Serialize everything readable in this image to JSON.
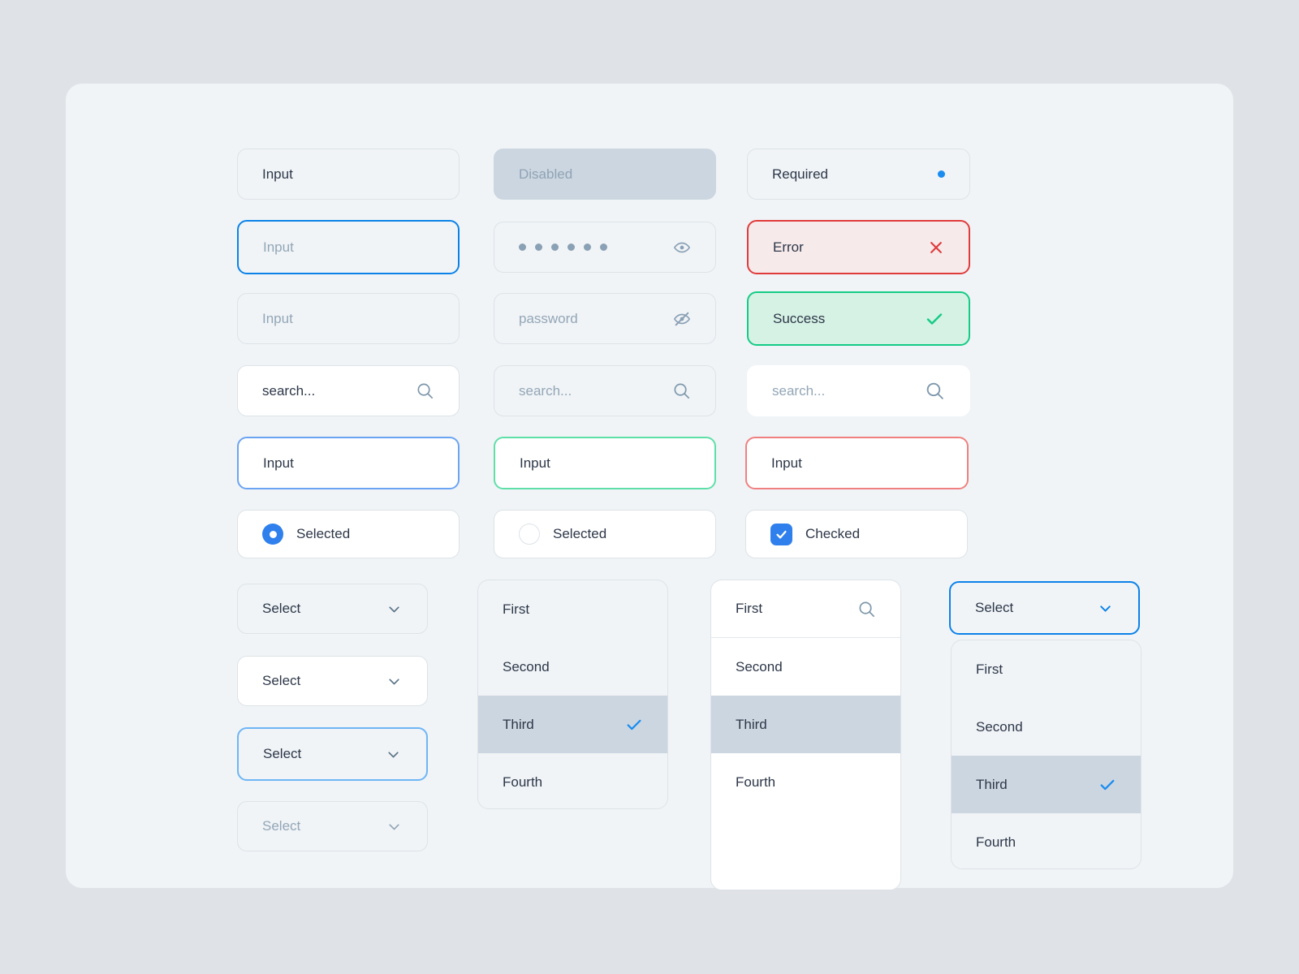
{
  "colors": {
    "page_bg": "#dfe2e6",
    "card_bg": "#f0f4f7",
    "accent_blue": "#0b82e8",
    "error_red": "#e03b3b",
    "success_green": "#14cb85",
    "muted_text": "#93a6b6",
    "text": "#2d3748",
    "selected_row": "#ccd6e0"
  },
  "inputs": {
    "row1": {
      "default": {
        "value": "Input"
      },
      "disabled": {
        "value": "Disabled"
      },
      "required": {
        "value": "Required",
        "indicator": "required-dot"
      }
    },
    "row2": {
      "focused": {
        "placeholder": "Input"
      },
      "password_filled": {
        "value": "••••••",
        "dots": 6,
        "icon": "eye-icon"
      },
      "error": {
        "value": "Error",
        "icon": "close-x-icon"
      }
    },
    "row3": {
      "muted": {
        "placeholder": "Input"
      },
      "password_empty": {
        "placeholder": "password",
        "icon": "eye-off-icon"
      },
      "success": {
        "value": "Success",
        "icon": "check-icon"
      }
    },
    "row4": {
      "search_filled": {
        "value": "search...",
        "icon": "search-icon"
      },
      "search_muted": {
        "placeholder": "search...",
        "icon": "search-icon"
      },
      "search_white": {
        "placeholder": "search...",
        "icon": "search-icon"
      }
    },
    "row5": {
      "blue_border": {
        "value": "Input"
      },
      "green_border": {
        "value": "Input"
      },
      "red_border": {
        "value": "Input"
      }
    }
  },
  "controls": {
    "radio_selected": {
      "label": "Selected",
      "state": "on"
    },
    "radio_unselected": {
      "label": "Selected",
      "state": "off"
    },
    "checkbox_checked": {
      "label": "Checked",
      "state": "on"
    }
  },
  "selects": {
    "default": {
      "value": "Select",
      "icon": "chevron-down-icon"
    },
    "white": {
      "value": "Select",
      "icon": "chevron-down-icon"
    },
    "focused": {
      "value": "Select",
      "icon": "chevron-down-icon"
    },
    "disabled": {
      "value": "Select",
      "icon": "chevron-down-icon"
    },
    "open": {
      "value": "Select",
      "icon": "chevron-down-icon"
    }
  },
  "dropdowns": {
    "grey_panel": {
      "options": [
        {
          "label": "First",
          "selected": false
        },
        {
          "label": "Second",
          "selected": false
        },
        {
          "label": "Third",
          "selected": true
        },
        {
          "label": "Fourth",
          "selected": false
        }
      ]
    },
    "white_panel_search": {
      "search_row": {
        "label": "First",
        "icon": "search-icon"
      },
      "options": [
        {
          "label": "Second",
          "selected": false
        },
        {
          "label": "Third",
          "selected": true
        },
        {
          "label": "Fourth",
          "selected": false
        }
      ]
    },
    "open_panel": {
      "options": [
        {
          "label": "First",
          "selected": false
        },
        {
          "label": "Second",
          "selected": false
        },
        {
          "label": "Third",
          "selected": true
        },
        {
          "label": "Fourth",
          "selected": false
        }
      ]
    }
  }
}
